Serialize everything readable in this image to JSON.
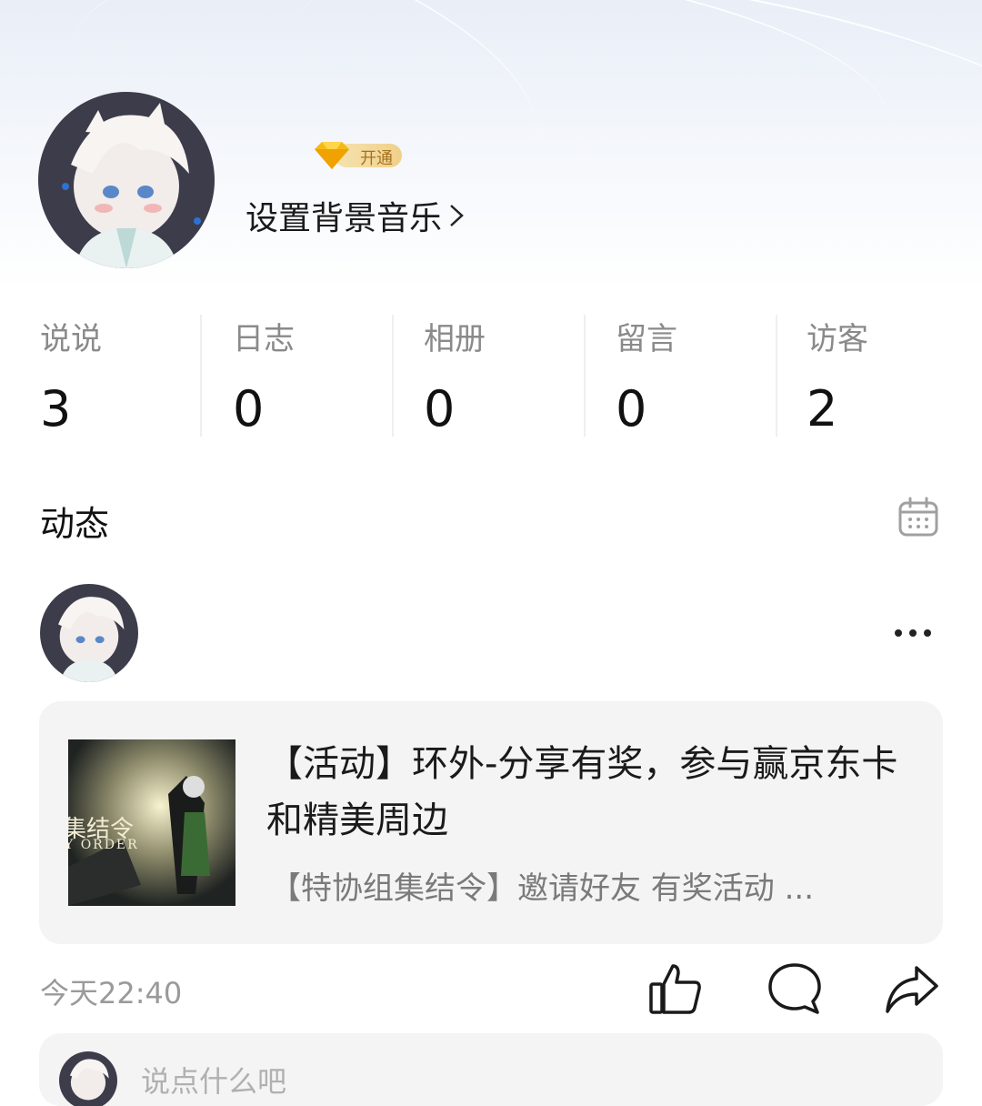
{
  "profile": {
    "vip_label": "开通",
    "music_link": "设置背景音乐"
  },
  "stats": [
    {
      "label": "说说",
      "value": "3"
    },
    {
      "label": "日志",
      "value": "0"
    },
    {
      "label": "相册",
      "value": "0"
    },
    {
      "label": "留言",
      "value": "0"
    },
    {
      "label": "访客",
      "value": "2"
    }
  ],
  "feed": {
    "title": "动态",
    "post": {
      "share": {
        "title": "【活动】环外-分享有奖，参与赢京东卡和精美周边",
        "description": "【特协组集结令】邀请好友 有奖活动 ...",
        "thumb_text": "集结令",
        "thumb_subtext": "Y ORDER"
      },
      "time": "今天22:40",
      "comment_placeholder": "说点什么吧"
    }
  },
  "icons": {
    "vip": "diamond-icon",
    "music_arrow": "chevron-right-icon",
    "calendar": "calendar-icon",
    "more": "more-dots-icon",
    "like": "thumbs-up-icon",
    "comment": "comment-bubble-icon",
    "share": "share-arrow-icon"
  },
  "colors": {
    "accent_gold": "#f0d08a",
    "card_bg": "#f4f4f5",
    "muted_text": "#8a8a8a"
  }
}
